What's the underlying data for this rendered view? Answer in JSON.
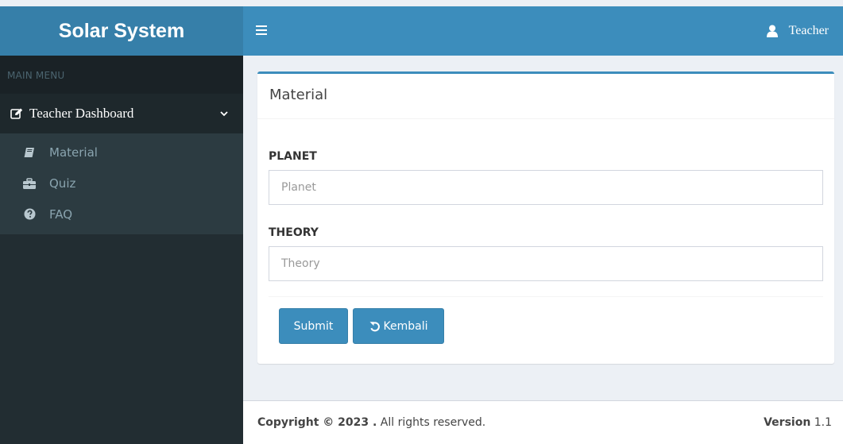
{
  "app": {
    "title": "Solar System"
  },
  "topbar": {
    "user_name": "Teacher"
  },
  "sidebar": {
    "header": "MAIN MENU",
    "dashboard_label": "Teacher Dashboard",
    "items": [
      {
        "label": "Material",
        "icon": "book-icon"
      },
      {
        "label": "Quiz",
        "icon": "briefcase-icon"
      },
      {
        "label": "FAQ",
        "icon": "question-circle-icon"
      }
    ]
  },
  "form": {
    "title": "Material",
    "planet_label": "PLANET",
    "planet_placeholder": "Planet",
    "theory_label": "THEORY",
    "theory_placeholder": "Theory",
    "submit_label": "Submit",
    "back_label": "Kembali"
  },
  "footer": {
    "copyright_bold": "Copyright © 2023 .",
    "copyright_rest": " All rights reserved.",
    "version_label": "Version",
    "version_value": " 1.1"
  },
  "colors": {
    "primary": "#3c8dbc",
    "primary_dark": "#367fa9",
    "sidebar_bg": "#222d32",
    "content_bg": "#ecf0f5"
  }
}
